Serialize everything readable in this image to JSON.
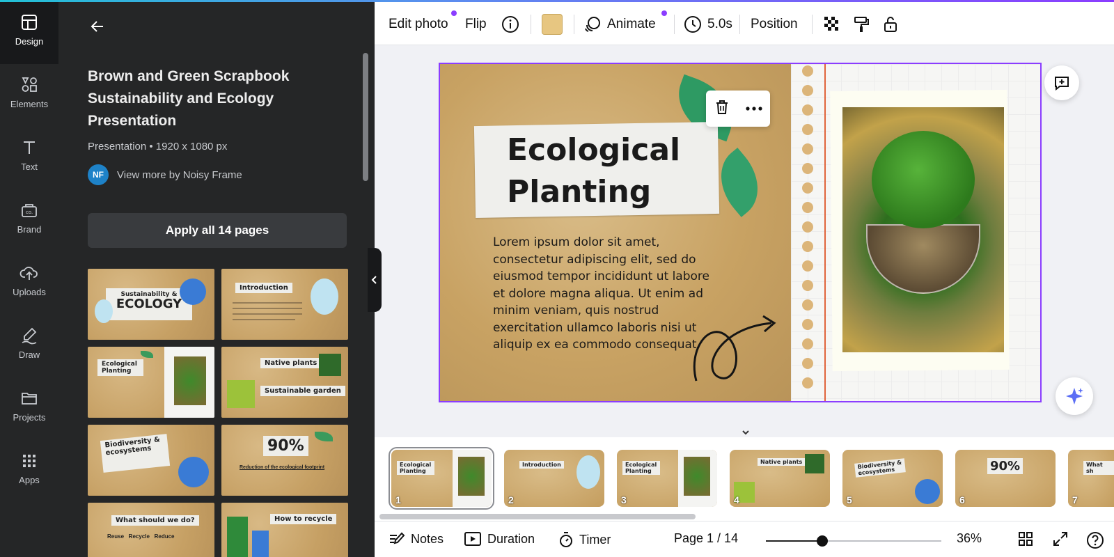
{
  "rail": {
    "items": [
      {
        "label": "Design",
        "icon": "layout-icon"
      },
      {
        "label": "Elements",
        "icon": "shapes-icon"
      },
      {
        "label": "Text",
        "icon": "text-icon"
      },
      {
        "label": "Brand",
        "icon": "brand-icon"
      },
      {
        "label": "Uploads",
        "icon": "cloud-upload-icon"
      },
      {
        "label": "Draw",
        "icon": "pen-icon"
      },
      {
        "label": "Projects",
        "icon": "folder-icon"
      },
      {
        "label": "Apps",
        "icon": "apps-grid-icon"
      }
    ]
  },
  "panel": {
    "title": "Brown and Green Scrapbook Sustainability and Ecology Presentation",
    "meta": "Presentation • 1920 x 1080 px",
    "author_initials": "NF",
    "author_link": "View more by Noisy Frame",
    "apply_label": "Apply all 14 pages",
    "thumbs": [
      {
        "heading": "Sustainability &",
        "sub": "ECOLOGY"
      },
      {
        "heading": "Introduction",
        "sub": ""
      },
      {
        "heading": "Ecological Planting",
        "sub": ""
      },
      {
        "heading": "Native plants",
        "sub": "Sustainable garden"
      },
      {
        "heading": "Biodiversity & ecosystems",
        "sub": ""
      },
      {
        "heading": "90%",
        "sub": "Reduction of the ecological footprint"
      },
      {
        "heading": "What should we do?",
        "sub": "Reuse   Recycle   Reduce"
      },
      {
        "heading": "How to recycle",
        "sub": ""
      }
    ]
  },
  "toolbar": {
    "edit_photo": "Edit photo",
    "flip": "Flip",
    "animate": "Animate",
    "duration": "5.0s",
    "position": "Position",
    "swatch_color": "#e7c681"
  },
  "slide": {
    "title_line1": "Ecological",
    "title_line2": "Planting",
    "body": "Lorem ipsum dolor sit amet, consectetur adipiscing elit, sed do eiusmod tempor incididunt ut labore et dolore magna aliqua. Ut enim ad minim veniam, quis nostrud exercitation ullamco laboris nisi ut aliquip ex ea commodo consequat."
  },
  "filmstrip": {
    "pages": [
      {
        "num": "1",
        "label": "Ecological Planting"
      },
      {
        "num": "2",
        "label": "Introduction"
      },
      {
        "num": "3",
        "label": "Ecological Planting"
      },
      {
        "num": "4",
        "label": "Native plants"
      },
      {
        "num": "5",
        "label": "Biodiversity & ecosystems"
      },
      {
        "num": "6",
        "label": "90%"
      },
      {
        "num": "7",
        "label": "What sh"
      }
    ]
  },
  "bottombar": {
    "notes": "Notes",
    "duration": "Duration",
    "timer": "Timer",
    "page_indicator": "Page 1 / 14",
    "zoom": "36%",
    "zoom_level": 0.36
  }
}
